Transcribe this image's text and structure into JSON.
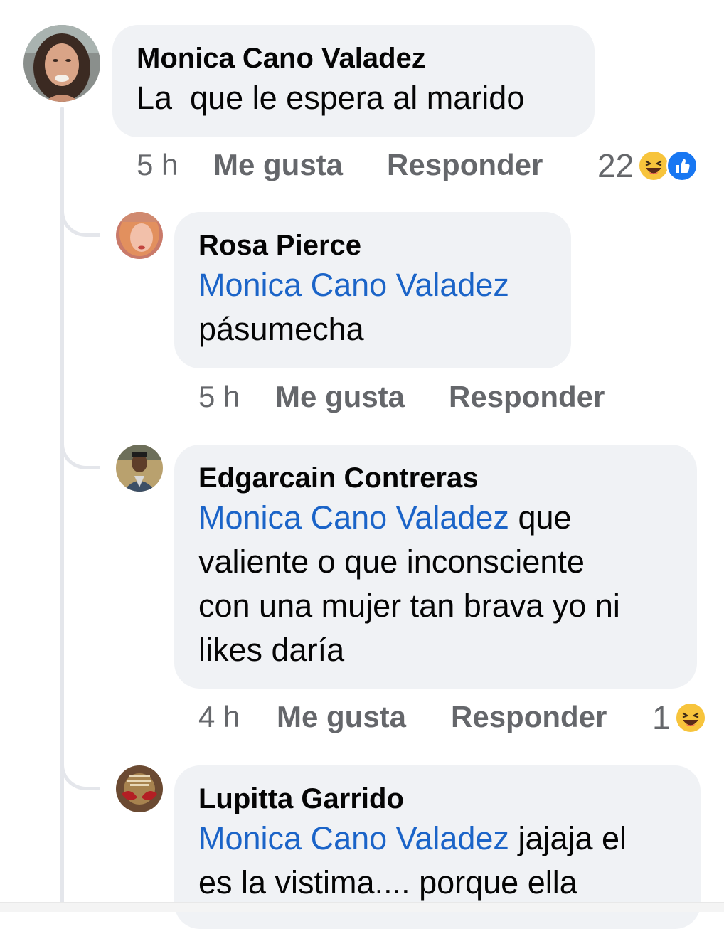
{
  "comments": [
    {
      "author": "Monica Cano Valadez",
      "text": "La  que le espera al marido",
      "time": "5 h",
      "like_label": "Me gusta",
      "reply_label": "Responder",
      "reaction_count": "22",
      "reactions": [
        "haha-icon",
        "like-icon"
      ]
    },
    {
      "author": "Rosa Pierce",
      "mention": "Monica Cano Valadez",
      "text_lines": [
        "pásumecha"
      ],
      "time": "5 h",
      "like_label": "Me gusta",
      "reply_label": "Responder"
    },
    {
      "author": "Edgarcain Contreras",
      "mention": "Monica Cano Valadez",
      "line1_rest": " que",
      "text_lines": [
        "valiente o que inconsciente",
        "con una mujer tan brava yo ni",
        "likes daría"
      ],
      "time": "4 h",
      "like_label": "Me gusta",
      "reply_label": "Responder",
      "reaction_count": "1",
      "reactions": [
        "haha-icon"
      ]
    },
    {
      "author": "Lupitta Garrido",
      "mention": "Monica Cano Valadez",
      "line1_rest": " jajaja el",
      "text_lines": [
        "es la vistima.... porque ella"
      ]
    }
  ],
  "colors": {
    "bubble": "#f0f2f5",
    "mention": "#1b64c8",
    "meta": "#65676b",
    "thread_line": "#e4e6eb"
  }
}
